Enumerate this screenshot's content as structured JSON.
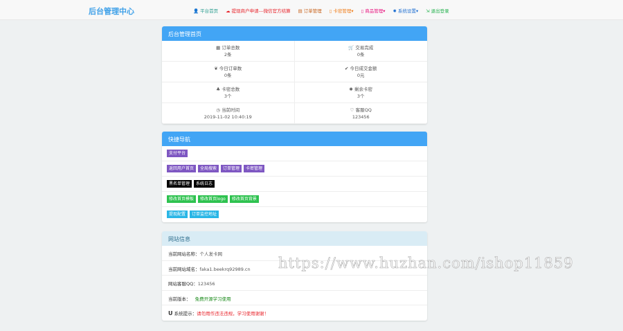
{
  "navbar": {
    "brand": "后台管理中心",
    "items": [
      {
        "label": "平台首页",
        "icon": "user-icon",
        "color": "#2a9d8f"
      },
      {
        "label": "提现商户申请---微信官方结算",
        "icon": "cloud-icon",
        "color": "#e8242b"
      },
      {
        "label": "订单管理",
        "icon": "list-icon",
        "color": "#c8641e"
      },
      {
        "label": "卡密管理▾",
        "icon": "tablet-icon",
        "color": "#f07f1e"
      },
      {
        "label": "商品管理▾",
        "icon": "tablet-icon",
        "color": "#e8157f"
      },
      {
        "label": "系统设置▾",
        "icon": "gear-icon",
        "color": "#1f6fd1"
      },
      {
        "label": "退出登录",
        "icon": "logout-icon",
        "color": "#22b14c"
      }
    ]
  },
  "stats": {
    "title": "后台管理首页",
    "items": [
      {
        "icon": "▦",
        "label": "订单总数",
        "value": "2条"
      },
      {
        "icon": "🛒",
        "label": "交易完成",
        "value": "0条"
      },
      {
        "icon": "❦",
        "label": "今日订单数",
        "value": "0条"
      },
      {
        "icon": "✔",
        "label": "今日成交金额",
        "value": "0元"
      },
      {
        "icon": "♣",
        "label": "卡密总数",
        "value": "3个"
      },
      {
        "icon": "✱",
        "label": "剩余卡密",
        "value": "3个"
      },
      {
        "icon": "◷",
        "label": "当前时间",
        "value": "2019-11-02 10:40:19"
      },
      {
        "icon": "♡",
        "label": "客服QQ",
        "value": "123456"
      }
    ]
  },
  "quicknav": {
    "title": "快捷导航",
    "rows": [
      [
        "支付平台"
      ],
      [
        "返回用户首页",
        "全局搜索",
        "订单管理",
        "卡密管理"
      ],
      [
        "黑名单管理",
        "系统日志"
      ],
      [
        "修改首页模板",
        "修改首页logo",
        "修改首页背景"
      ],
      [
        "提现配置",
        "订单监控地址"
      ]
    ]
  },
  "siteinfo": {
    "title": "网站信息",
    "name_label": "当前网站名称：",
    "name": "个人发卡网",
    "domain_label": "当前网站域名：",
    "domain": "faka1.beekrq92989.cn",
    "qq_label": "网站客服QQ：",
    "qq": "123456",
    "version_label": "当前版本：",
    "version": "免费开源学习使用",
    "tip_icon": "U",
    "tip_label": "系统提示：",
    "tip": "请勿用作违法违规，学习使用谢谢！"
  },
  "watermark": "https://www.huzhan.com/ishop11859"
}
